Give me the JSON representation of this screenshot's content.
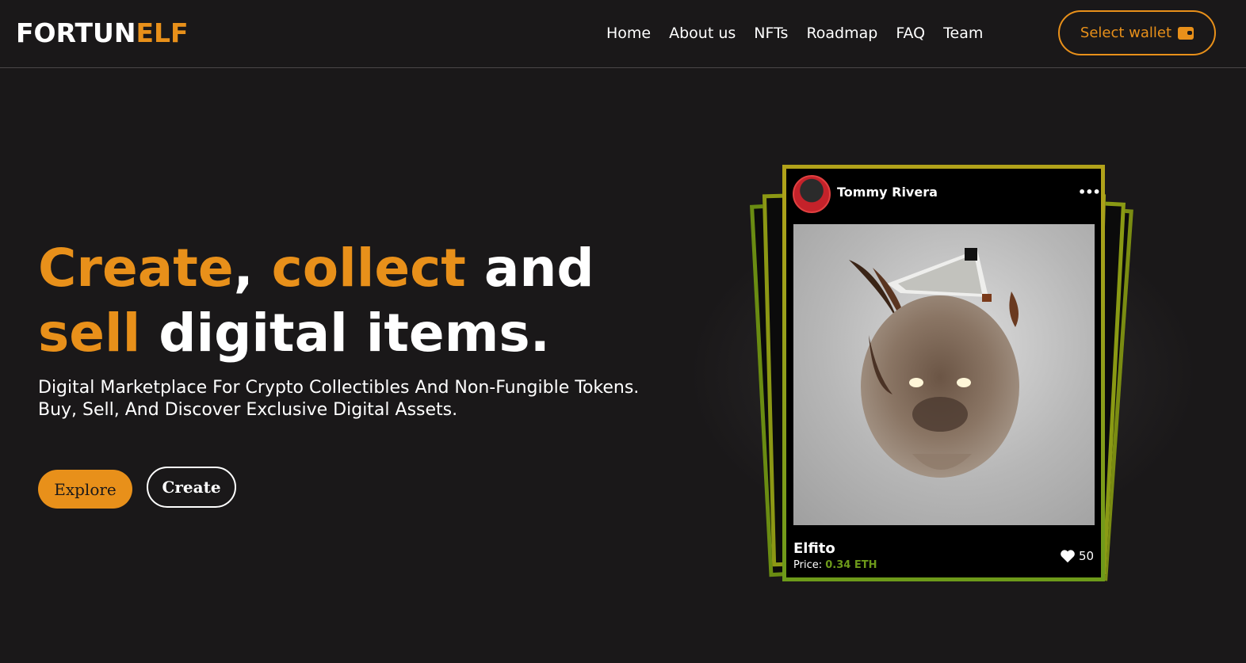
{
  "header": {
    "logo_part1": "FORTUN",
    "logo_part2": "ELF",
    "nav": [
      "Home",
      "About us",
      "NFTs",
      "Roadmap",
      "FAQ",
      "Team"
    ],
    "wallet_label": "Select wallet",
    "wallet_icon": "wallet-icon"
  },
  "hero": {
    "title_word1": "Create",
    "title_comma": ",",
    "title_word2": "collect",
    "title_word3": "and",
    "title_word4": "sell",
    "title_word5": "digital items.",
    "subtitle": "Digital Marketplace For Crypto Collectibles And Non-Fungible Tokens. Buy, Sell, And Discover Exclusive Digital Assets.",
    "explore_label": "Explore",
    "create_label": "Create"
  },
  "card": {
    "author": "Tommy Rivera",
    "more": "•••",
    "name": "Elfito",
    "price_label": "Price:",
    "price_value": "0.34 ETH",
    "likes": "50",
    "like_icon": "heart-icon"
  },
  "colors": {
    "accent": "#e8901a",
    "background": "#1a1819",
    "price": "#6d9a1a"
  }
}
